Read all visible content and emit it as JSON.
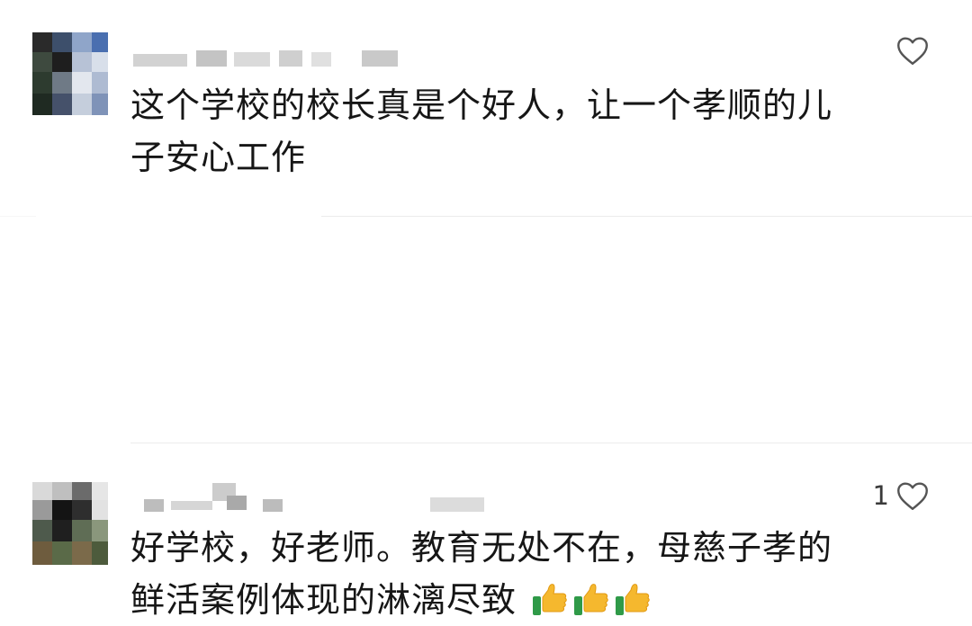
{
  "comments": [
    {
      "username_redacted": true,
      "text_line1": "这个学校的校长真是个好人，让一个孝顺的儿",
      "text_line2": "子安心工作",
      "like_count": "",
      "icons": [
        "avatar-pixelated",
        "heart-outline-icon"
      ]
    },
    {
      "username_redacted": true,
      "text_line1": "好学校，好老师。教育无处不在，母慈子孝的",
      "text_line2": "鲜活案例体现的淋漓尽致",
      "like_count": "1",
      "emojis": [
        "thumbs-up-icon",
        "thumbs-up-icon",
        "thumbs-up-icon"
      ],
      "icons": [
        "avatar-pixelated",
        "heart-outline-icon"
      ]
    }
  ],
  "colors": {
    "text": "#161616",
    "muted": "#3a3a3a",
    "divider": "#ececec",
    "heart_stroke": "#555555",
    "thumb_yellow": "#f5b82e",
    "thumb_cuff": "#2f9a48"
  }
}
